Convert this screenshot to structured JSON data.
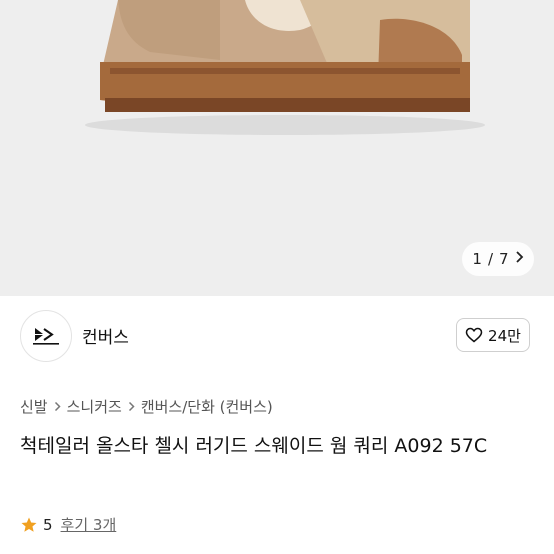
{
  "gallery": {
    "pager_current": "1",
    "pager_separator": "/",
    "pager_total": "7"
  },
  "brand": {
    "name": "컨버스",
    "likes": "24만"
  },
  "breadcrumb": [
    "신발",
    "스니커즈",
    "캔버스/단화 (컨버스)"
  ],
  "product": {
    "title": "척테일러 올스타 첼시 러기드 스웨이드 웜 쿼리 A092 57C"
  },
  "rating": {
    "score": "5",
    "reviews": "후기 3개",
    "star_color": "#f0a020"
  },
  "icons": {
    "next": "chevron-right-icon",
    "heart": "heart-outline-icon",
    "star": "star-icon",
    "logo": "converse-logo"
  }
}
